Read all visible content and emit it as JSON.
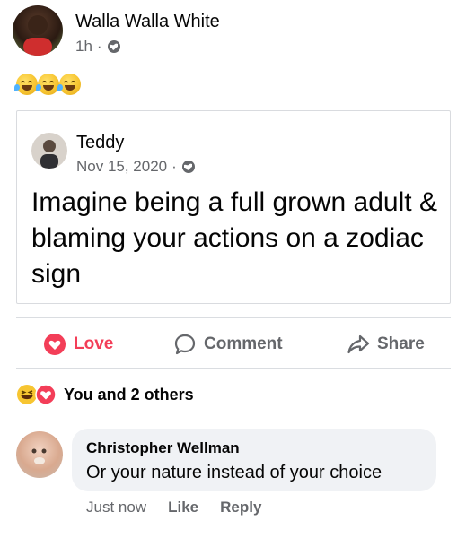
{
  "post": {
    "author": "Walla Walla White",
    "time": "1h",
    "separator": "·",
    "privacy_icon": "globe-icon",
    "emoji_count": 3,
    "emoji_icon": "rolling-on-floor-laughing-emoji"
  },
  "shared": {
    "author": "Teddy",
    "date": "Nov 15, 2020",
    "separator": "·",
    "privacy_icon": "globe-icon",
    "text": "Imagine being a full grown adult & blaming your actions on a zodiac sign"
  },
  "actions": {
    "love": "Love",
    "comment": "Comment",
    "share": "Share",
    "love_color": "#f33e58"
  },
  "reactions": {
    "summary": "You and 2 others",
    "icons": [
      "haha-icon",
      "love-icon"
    ]
  },
  "comment": {
    "author": "Christopher Wellman",
    "text": "Or your nature instead of your choice",
    "time": "Just now",
    "like": "Like",
    "reply": "Reply"
  }
}
